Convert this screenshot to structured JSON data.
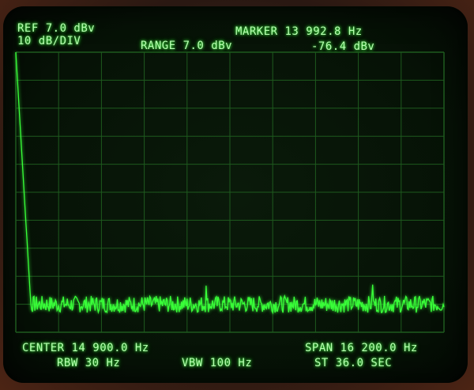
{
  "header": {
    "ref_level": "REF 7.0 dBv",
    "scale": "10 dB/DIV",
    "range": "RANGE 7.0 dBv",
    "marker_freq": "MARKER 13 992.8 Hz",
    "marker_level": "-76.4 dBv"
  },
  "footer": {
    "center": "CENTER 14 900.0 Hz",
    "span": "SPAN 16 200.0 Hz",
    "rbw": "RBW 30 Hz",
    "vbw": "VBW 100 Hz",
    "sweep_time": "ST 36.0 SEC"
  },
  "colors": {
    "trace": "#39ff39",
    "grid": "#1e5a1e",
    "text": "#b6ffb0"
  },
  "chart_data": {
    "type": "line",
    "ref_level_dbv": 7.0,
    "db_per_div": 10,
    "vertical_divisions": 10,
    "horizontal_divisions": 10,
    "center_hz": 14900.0,
    "span_hz": 16200.0,
    "xlim": [
      6800,
      23000
    ],
    "ylim": [
      -93,
      7
    ],
    "noise_floor_dbv": -83,
    "noise_variation_db": 3,
    "peaks": [
      {
        "x": 6800,
        "y": 7.0
      },
      {
        "x": 13992.8,
        "y": -76.4
      },
      {
        "x": 20300,
        "y": -76
      }
    ],
    "marker": {
      "x": 13992.8,
      "y": -76.4
    }
  }
}
